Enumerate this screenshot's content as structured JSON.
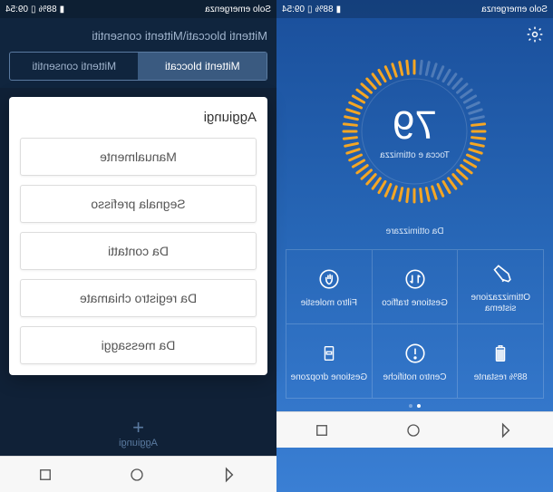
{
  "status": {
    "time": "09:54",
    "battery_pct": "88%",
    "carrier": "Solo emergenza"
  },
  "left": {
    "breadcrumb": "Mittenti bloccati\\Mittenti consentiti",
    "tabs": {
      "blocked": "Mittenti bloccati",
      "allowed": "Mittenti consentiti"
    },
    "dialog": {
      "title": "Aggiungi",
      "options": {
        "manual": "Manualmente",
        "prefix": "Segnala prefisso",
        "contacts": "Da contatti",
        "calllog": "Da registro chiamate",
        "messages": "Da messaggi"
      }
    },
    "add_label": "Aggiungi"
  },
  "right": {
    "score": "79",
    "score_sub": "Tocca e ottimizza",
    "optimize_text": "Da ottimizzare",
    "grid": {
      "system_opt": "Ottimizzazione sistema",
      "traffic": "Gestione traffico",
      "harassment": "Filtro molestie",
      "battery": "88% restante",
      "notifications": "Centro notifiche",
      "dropzone": "Gestione dropzone"
    }
  }
}
